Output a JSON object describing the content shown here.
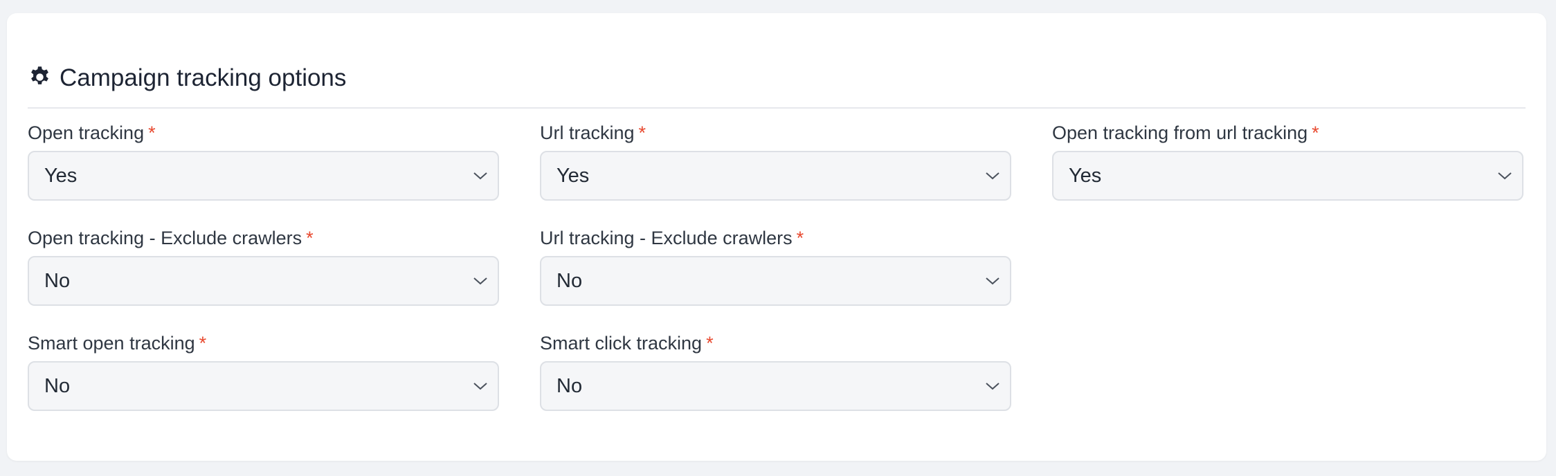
{
  "panel": {
    "title": "Campaign tracking options",
    "icon": "gear-icon"
  },
  "required_marker": "*",
  "fields": {
    "open_tracking": {
      "label": "Open tracking",
      "value": "Yes"
    },
    "url_tracking": {
      "label": "Url tracking",
      "value": "Yes"
    },
    "open_tracking_from_url": {
      "label": "Open tracking from url tracking",
      "value": "Yes"
    },
    "open_tracking_exclude_crawlers": {
      "label": "Open tracking - Exclude crawlers",
      "value": "No"
    },
    "url_tracking_exclude_crawlers": {
      "label": "Url tracking - Exclude crawlers",
      "value": "No"
    },
    "smart_open_tracking": {
      "label": "Smart open tracking",
      "value": "No"
    },
    "smart_click_tracking": {
      "label": "Smart click tracking",
      "value": "No"
    }
  },
  "colors": {
    "required": "#e8492f",
    "heading": "#1d2433",
    "select_background": "#f5f6f8",
    "select_border": "#dde0e5"
  }
}
